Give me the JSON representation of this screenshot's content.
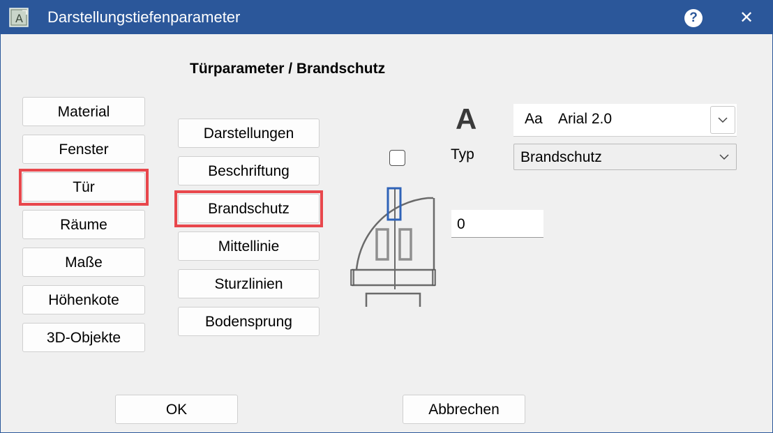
{
  "window": {
    "title": "Darstellungstiefenparameter",
    "help_label": "?",
    "close_label": "✕",
    "accent": "#2b579a"
  },
  "heading": "Türparameter / Brandschutz",
  "categories": [
    {
      "label": "Material"
    },
    {
      "label": "Fenster"
    },
    {
      "label": "Tür"
    },
    {
      "label": "Räume"
    },
    {
      "label": "Maße"
    },
    {
      "label": "Höhenkote"
    },
    {
      "label": "3D-Objekte"
    }
  ],
  "subcategories": [
    {
      "label": "Darstellungen"
    },
    {
      "label": "Beschriftung"
    },
    {
      "label": "Brandschutz"
    },
    {
      "label": "Mittellinie"
    },
    {
      "label": "Sturzlinien"
    },
    {
      "label": "Bodensprung"
    }
  ],
  "selected_category": "Tür",
  "selected_subcategory": "Brandschutz",
  "highlight_color": "#e8474c",
  "font": {
    "icon_label": "A",
    "aa_label": "Aa",
    "value": "Arial 2.0"
  },
  "typ": {
    "label": "Typ",
    "value": "Brandschutz"
  },
  "checkbox_checked": false,
  "number_value": "0",
  "footer": {
    "ok_label": "OK",
    "cancel_label": "Abbrechen"
  }
}
